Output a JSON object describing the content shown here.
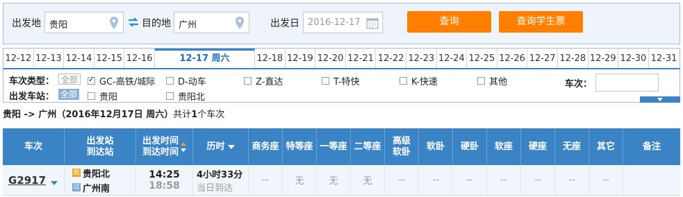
{
  "search": {
    "from_label": "出发地",
    "from_value": "贵阳",
    "to_label": "目的地",
    "to_value": "广州",
    "date_label": "出发日",
    "date_value": "2016-12-17",
    "query_button": "查询",
    "student_button": "查询学生票"
  },
  "dates": [
    "12-12",
    "12-13",
    "12-14",
    "12-15",
    "12-16",
    "12-17 周六",
    "12-18",
    "12-19",
    "12-20",
    "12-21",
    "12-22",
    "12-23",
    "12-24",
    "12-25",
    "12-26",
    "12-27",
    "12-28",
    "12-29",
    "12-30",
    "12-31"
  ],
  "filter": {
    "type_label": "车次类型：",
    "all_label": "全部",
    "types": [
      "GC-高铁/城际",
      "D-动车",
      "Z-直达",
      "T-特快",
      "K-快速",
      "其他"
    ],
    "station_label": "出发车站：",
    "stations": [
      "贵阳",
      "贵阳北"
    ],
    "train_no_label": "车次："
  },
  "summary": {
    "route": "贵阳 -> 广州（2016年12月17日 周六）",
    "prefix": "共计",
    "count": "1",
    "suffix": "个车次"
  },
  "table": {
    "headers": {
      "train": "车次",
      "station_line1": "出发站",
      "station_line2": "到达站",
      "time_line1": "出发时间",
      "time_line2": "到达时间",
      "duration": "历时",
      "business": "商务座",
      "special": "特等座",
      "first": "一等座",
      "second": "二等座",
      "adv_soft_line1": "高级",
      "adv_soft_line2": "软卧",
      "soft_sleeper": "软卧",
      "hard_sleeper": "硬卧",
      "soft_seat": "软座",
      "hard_seat": "硬座",
      "no_seat": "无座",
      "other": "其它",
      "note": "备注"
    },
    "rows": [
      {
        "train": "G2917",
        "from_badge": "始",
        "from": "贵阳北",
        "to_badge": "过",
        "to": "广州南",
        "depart": "14:25",
        "arrive": "18:58",
        "duration": "4小时33分",
        "arrive_day": "当日到达",
        "business": "--",
        "special": "无",
        "first": "无",
        "second": "无",
        "adv_soft": "--",
        "soft_sleeper": "--",
        "hard_sleeper": "--",
        "soft_seat": "--",
        "hard_seat": "--",
        "no_seat": "--",
        "other": "--",
        "note": ""
      }
    ]
  },
  "colors": {
    "accent": "#3a84c5",
    "button": "#ff8000",
    "panel": "#eef4fa"
  },
  "icons": [
    "map-pin-icon",
    "swap-arrows-icon",
    "calendar-icon",
    "sort-arrow-icon",
    "expand-arrow-icon"
  ]
}
